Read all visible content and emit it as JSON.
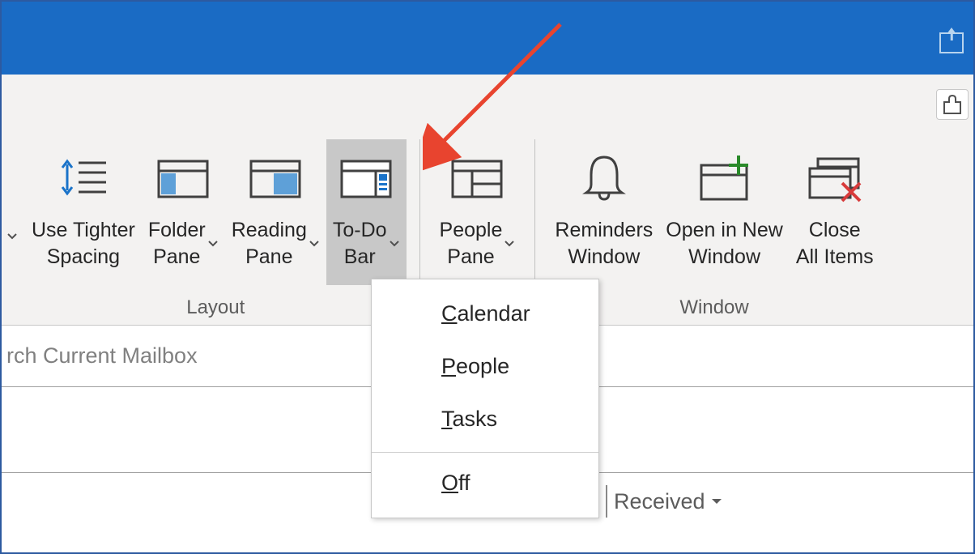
{
  "ribbon": {
    "groups": {
      "layout": {
        "label": "Layout",
        "buttons": {
          "tighter": "Use Tighter\nSpacing",
          "folder_pane": "Folder\nPane",
          "reading_pane": "Reading\nPane",
          "todo_bar": "To-Do\nBar"
        }
      },
      "people": {
        "label": "",
        "buttons": {
          "people_pane": "People\nPane"
        }
      },
      "window": {
        "label": "Window",
        "buttons": {
          "reminders": "Reminders\nWindow",
          "open_new": "Open in New\nWindow",
          "close_all": "Close\nAll Items"
        }
      }
    }
  },
  "todo_menu": {
    "calendar": "Calendar",
    "people": "People",
    "tasks": "Tasks",
    "off": "Off"
  },
  "search": {
    "placeholder": "rch Current Mailbox"
  },
  "sort": {
    "label": "Received"
  }
}
